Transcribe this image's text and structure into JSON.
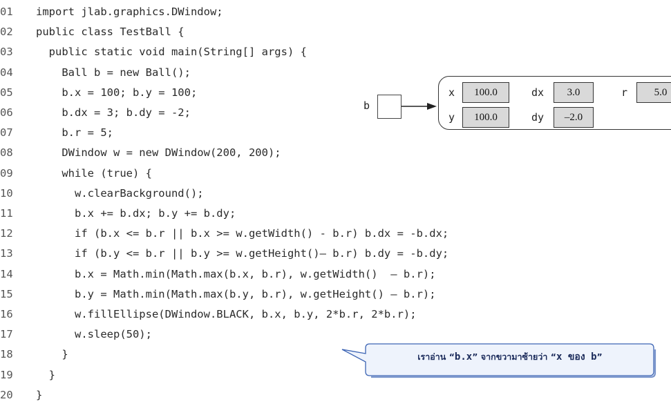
{
  "code_lines": [
    {
      "num": "01",
      "text": "import jlab.graphics.DWindow;"
    },
    {
      "num": "02",
      "text": "public class TestBall {"
    },
    {
      "num": "03",
      "text": "  public static void main(String[] args) {"
    },
    {
      "num": "04",
      "text": "    Ball b = new Ball();"
    },
    {
      "num": "05",
      "text": "    b.x = 100; b.y = 100;"
    },
    {
      "num": "06",
      "text": "    b.dx = 3; b.dy = -2;"
    },
    {
      "num": "07",
      "text": "    b.r = 5;"
    },
    {
      "num": "08",
      "text": "    DWindow w = new DWindow(200, 200);"
    },
    {
      "num": "09",
      "text": "    while (true) {"
    },
    {
      "num": "10",
      "text": "      w.clearBackground();"
    },
    {
      "num": "11",
      "text": "      b.x += b.dx; b.y += b.dy;"
    },
    {
      "num": "12",
      "text": "      if (b.x <= b.r || b.x >= w.getWidth() - b.r) b.dx = -b.dx;"
    },
    {
      "num": "13",
      "text": "      if (b.y <= b.r || b.y >= w.getHeight()– b.r) b.dy = -b.dy;"
    },
    {
      "num": "14",
      "text": "      b.x = Math.min(Math.max(b.x, b.r), w.getWidth()  – b.r);"
    },
    {
      "num": "15",
      "text": "      b.y = Math.min(Math.max(b.y, b.r), w.getHeight() – b.r);"
    },
    {
      "num": "16",
      "text": "      w.fillEllipse(DWindow.BLACK, b.x, b.y, 2*b.r, 2*b.r);"
    },
    {
      "num": "17",
      "text": "      w.sleep(50);"
    },
    {
      "num": "18",
      "text": "    }"
    },
    {
      "num": "19",
      "text": "  }"
    },
    {
      "num": "20",
      "text": "}"
    }
  ],
  "diagram": {
    "reference_label": "b",
    "object_fields": [
      {
        "label": "x",
        "value": "100.0"
      },
      {
        "label": "dx",
        "value": "3.0"
      },
      {
        "label": "r",
        "value": "5.0"
      },
      {
        "label": "y",
        "value": "100.0"
      },
      {
        "label": "dy",
        "value": "–2.0"
      }
    ]
  },
  "callout": {
    "part1": "เราอ่าน “",
    "code1": "b.x",
    "part2": "” จากขวามาซ้ายว่า “",
    "code2": "x ของ b",
    "part3": "”"
  }
}
